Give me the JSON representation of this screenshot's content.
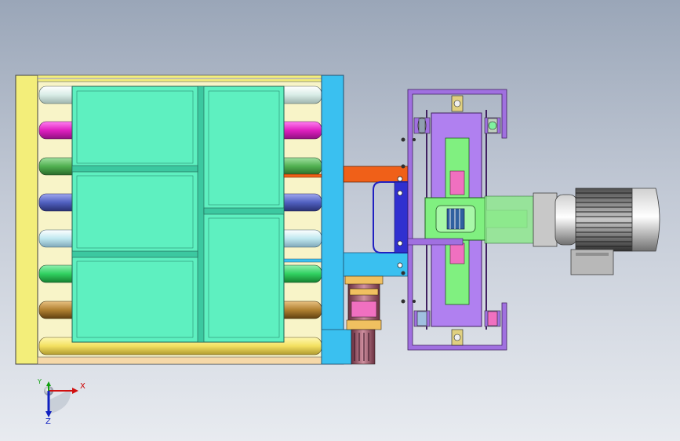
{
  "view": {
    "background_top": "#9aa6b8",
    "background_bottom": "#e8ebf0"
  },
  "triad": {
    "x_label": "X",
    "y_label": "Y",
    "z_label": "Z",
    "x_color": "#d01010",
    "y_color": "#10a010",
    "z_color": "#1020c0"
  },
  "colors": {
    "frame_yellow": "#f3ee7a",
    "tank_teal": "#5ef0c0",
    "side_blue": "#3ac0f0",
    "bracket_orange": "#f06018",
    "carriage_purple": "#a070e0",
    "panel_green": "#80f080",
    "motor_gray": "#a0a0a0",
    "plate_pink": "#f070c0"
  },
  "rollers": [
    {
      "name": "roller-white-top",
      "color": "#e8f4f0"
    },
    {
      "name": "roller-magenta",
      "color": "#e020c0"
    },
    {
      "name": "roller-green-1",
      "color": "#50b050"
    },
    {
      "name": "roller-blue",
      "color": "#5060c0"
    },
    {
      "name": "roller-lightblue",
      "color": "#c0e8f0"
    },
    {
      "name": "roller-green-2",
      "color": "#30d060"
    },
    {
      "name": "roller-olive",
      "color": "#b08030"
    }
  ]
}
